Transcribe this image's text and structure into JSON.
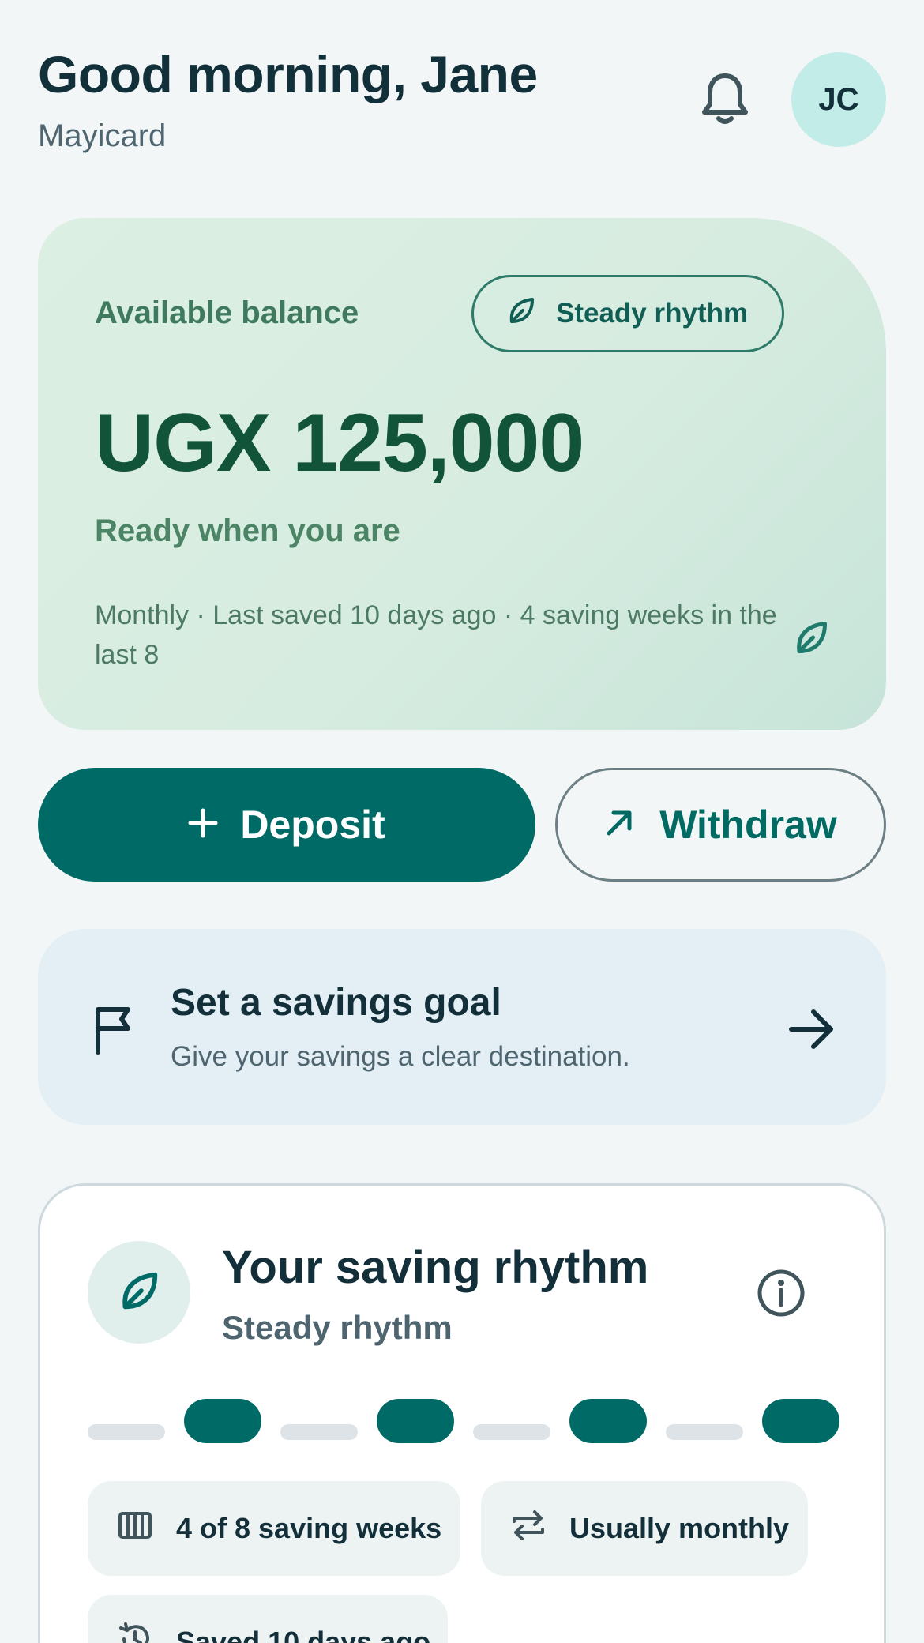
{
  "header": {
    "greeting": "Good morning, Jane",
    "subtitle": "Mayicard",
    "notification_icon": "bell-icon",
    "avatar_initials": "JC"
  },
  "balance": {
    "label": "Available balance",
    "badge": "Steady rhythm",
    "badge_icon": "leaf-icon",
    "amount": "UGX 125,000",
    "status": "Ready when you are",
    "meta": "Monthly · Last saved 10 days ago · 4 saving weeks in the last 8"
  },
  "actions": {
    "deposit_label": "Deposit",
    "deposit_icon": "plus-icon",
    "withdraw_label": "Withdraw",
    "withdraw_icon": "arrow-up-right-icon"
  },
  "goal": {
    "title": "Set a savings goal",
    "subtitle": "Give your savings a clear destination.",
    "icon": "flag-icon"
  },
  "rhythm": {
    "title": "Your saving rhythm",
    "subtitle": "Steady rhythm",
    "weeks": [
      false,
      true,
      false,
      true,
      false,
      true,
      false,
      true
    ],
    "chips": [
      {
        "label": "4 of 8 saving weeks",
        "icon": "calendar-bars-icon"
      },
      {
        "label": "Usually monthly",
        "icon": "repeat-icon"
      },
      {
        "label": "Saved 10 days ago",
        "icon": "history-icon"
      }
    ]
  },
  "colors": {
    "primary": "#006b66",
    "balance_text": "#115439",
    "background": "#f3f6f7"
  }
}
